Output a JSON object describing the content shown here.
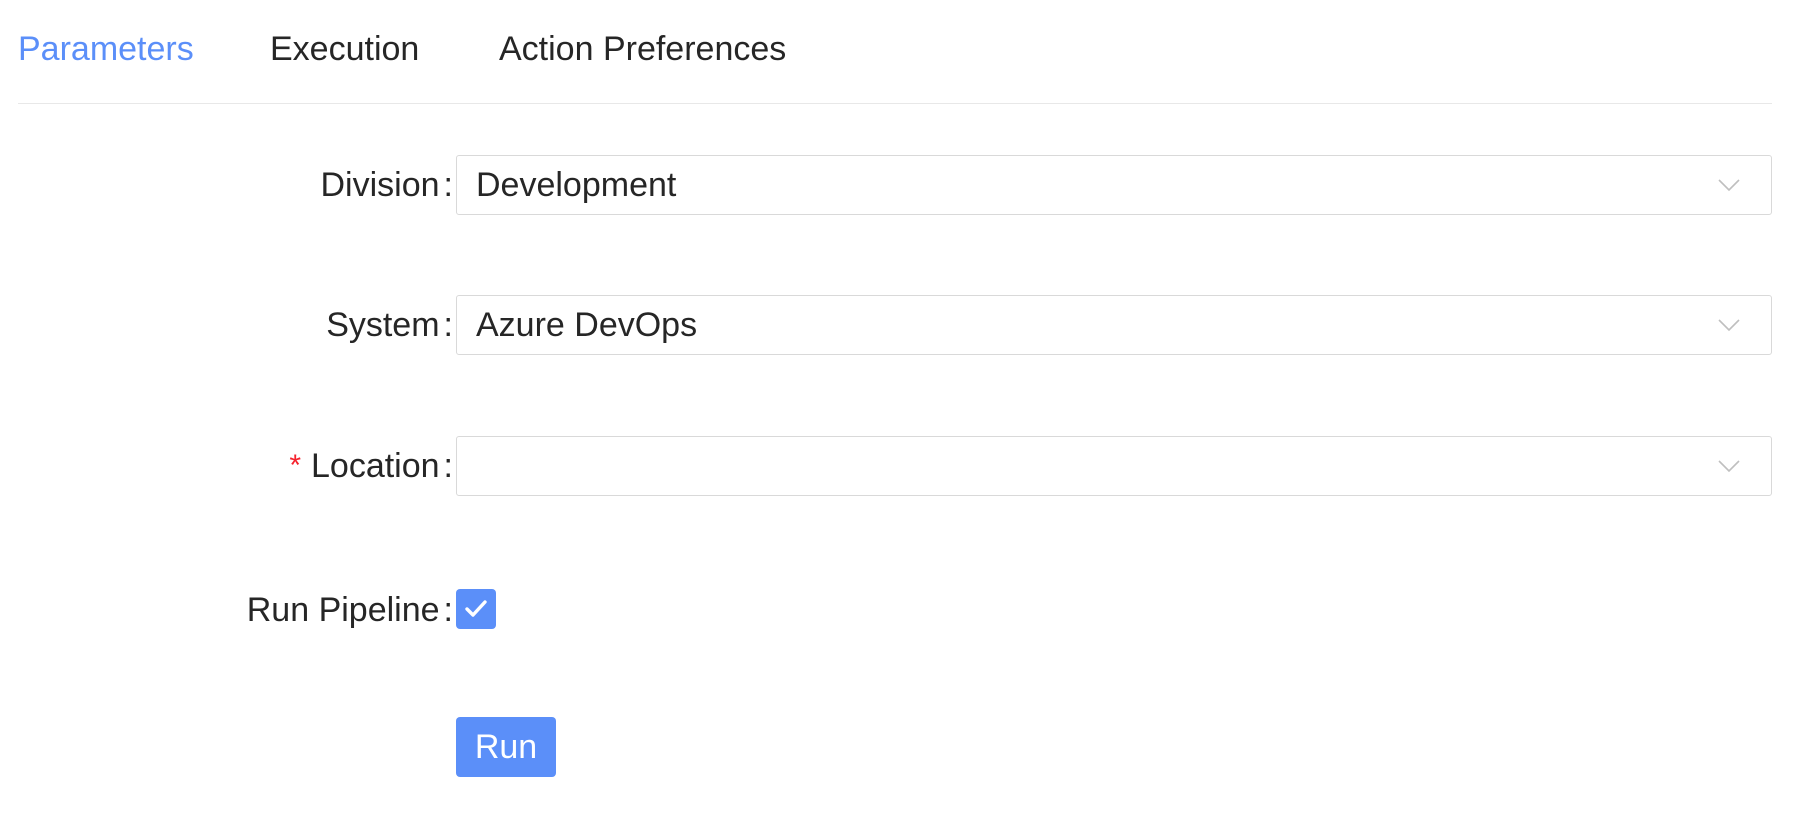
{
  "tabs": [
    {
      "label": "Parameters",
      "active": true
    },
    {
      "label": "Execution",
      "active": false
    },
    {
      "label": "Action Preferences",
      "active": false
    }
  ],
  "form": {
    "colon": ":",
    "division": {
      "label": "Division",
      "value": "Development",
      "icon": "chevron-down-icon"
    },
    "system": {
      "label": "System",
      "value": "Azure DevOps",
      "icon": "chevron-down-icon"
    },
    "location": {
      "label": "Location",
      "required_mark": "*",
      "value": "",
      "icon": "chevron-down-icon"
    },
    "run_pipeline": {
      "label": "Run Pipeline",
      "checked": true,
      "icon": "checkmark-icon"
    }
  },
  "run_button": {
    "label": "Run"
  },
  "colors": {
    "accent": "#5b8ff9",
    "required": "#f5222d",
    "border": "#d9d9d9",
    "text": "#262626"
  }
}
